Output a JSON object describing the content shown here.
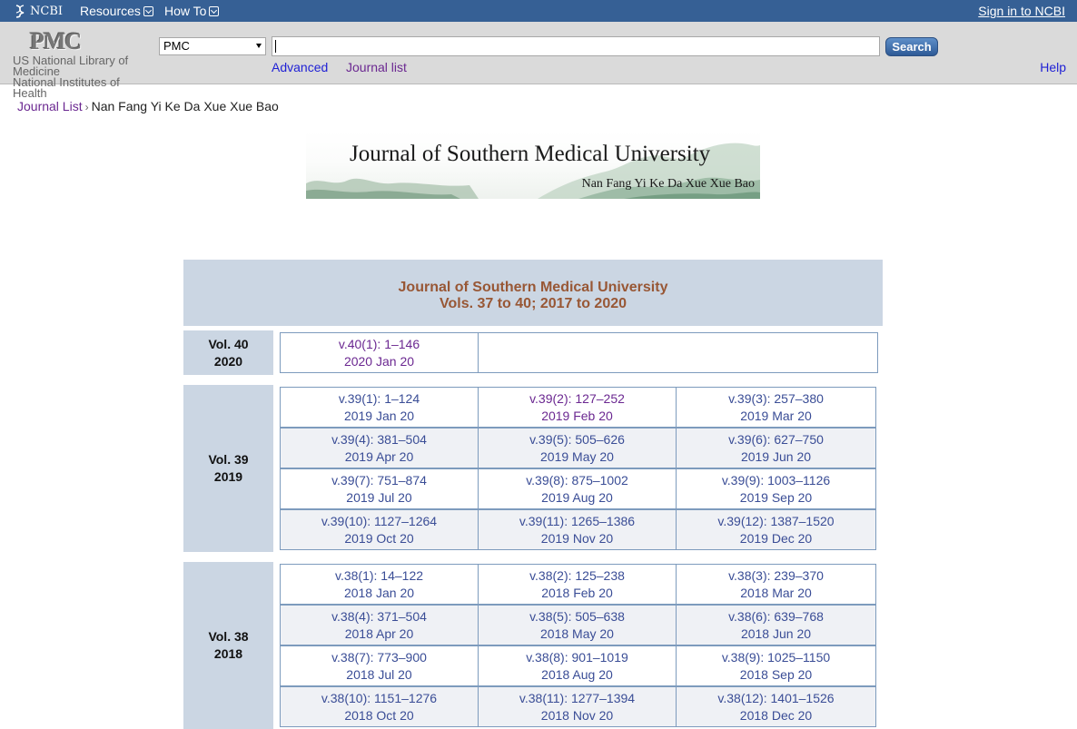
{
  "topbar": {
    "ncbi_label": "NCBI",
    "resources_label": "Resources",
    "howto_label": "How To",
    "signin_label": "Sign in to NCBI",
    "background": "#366095"
  },
  "header": {
    "logo_text": "PMC",
    "nlm_line1": "US National Library of Medicine",
    "nlm_line2": "National Institutes of Health",
    "db_selected": "PMC",
    "search_value": "",
    "search_button": "Search",
    "advanced_label": "Advanced",
    "journal_list_label": "Journal list",
    "help_label": "Help"
  },
  "breadcrumb": {
    "root": "Journal List",
    "current": "Nan Fang Yi Ke Da Xue Xue Bao"
  },
  "banner": {
    "title": "Journal of Southern Medical University",
    "subtitle": "Nan Fang Yi Ke Da Xue Xue Bao"
  },
  "table": {
    "title": "Journal of Southern Medical University",
    "subtitle": "Vols. 37 to 40;  2017 to 2020",
    "volumes": [
      {
        "vol": "Vol. 40",
        "year": "2020",
        "rows": [
          [
            {
              "range": "v.40(1): 1–146",
              "date": "2020 Jan 20",
              "visited": true
            }
          ]
        ]
      },
      {
        "vol": "Vol. 39",
        "year": "2019",
        "rows": [
          [
            {
              "range": "v.39(1): 1–124",
              "date": "2019 Jan 20",
              "visited": false
            },
            {
              "range": "v.39(2): 127–252",
              "date": "2019 Feb 20",
              "visited": true
            },
            {
              "range": "v.39(3): 257–380",
              "date": "2019 Mar 20",
              "visited": false
            }
          ],
          [
            {
              "range": "v.39(4): 381–504",
              "date": "2019 Apr 20",
              "visited": false
            },
            {
              "range": "v.39(5): 505–626",
              "date": "2019 May 20",
              "visited": false
            },
            {
              "range": "v.39(6): 627–750",
              "date": "2019 Jun 20",
              "visited": false
            }
          ],
          [
            {
              "range": "v.39(7): 751–874",
              "date": "2019 Jul 20",
              "visited": false
            },
            {
              "range": "v.39(8): 875–1002",
              "date": "2019 Aug 20",
              "visited": false
            },
            {
              "range": "v.39(9): 1003–1126",
              "date": "2019 Sep 20",
              "visited": false
            }
          ],
          [
            {
              "range": "v.39(10): 1127–1264",
              "date": "2019 Oct 20",
              "visited": false
            },
            {
              "range": "v.39(11): 1265–1386",
              "date": "2019 Nov 20",
              "visited": false
            },
            {
              "range": "v.39(12): 1387–1520",
              "date": "2019 Dec 20",
              "visited": false
            }
          ]
        ]
      },
      {
        "vol": "Vol. 38",
        "year": "2018",
        "rows": [
          [
            {
              "range": "v.38(1): 14–122",
              "date": "2018 Jan 20",
              "visited": false
            },
            {
              "range": "v.38(2): 125–238",
              "date": "2018 Feb 20",
              "visited": false
            },
            {
              "range": "v.38(3): 239–370",
              "date": "2018 Mar 20",
              "visited": false
            }
          ],
          [
            {
              "range": "v.38(4): 371–504",
              "date": "2018 Apr 20",
              "visited": false
            },
            {
              "range": "v.38(5): 505–638",
              "date": "2018 May 20",
              "visited": false
            },
            {
              "range": "v.38(6): 639–768",
              "date": "2018 Jun 20",
              "visited": false
            }
          ],
          [
            {
              "range": "v.38(7): 773–900",
              "date": "2018 Jul 20",
              "visited": false
            },
            {
              "range": "v.38(8): 901–1019",
              "date": "2018 Aug 20",
              "visited": false
            },
            {
              "range": "v.38(9): 1025–1150",
              "date": "2018 Sep 20",
              "visited": false
            }
          ],
          [
            {
              "range": "v.38(10): 1151–1276",
              "date": "2018 Oct 20",
              "visited": false
            },
            {
              "range": "v.38(11): 1277–1394",
              "date": "2018 Nov 20",
              "visited": false
            },
            {
              "range": "v.38(12): 1401–1526",
              "date": "2018 Dec 20",
              "visited": false
            }
          ]
        ]
      }
    ]
  }
}
